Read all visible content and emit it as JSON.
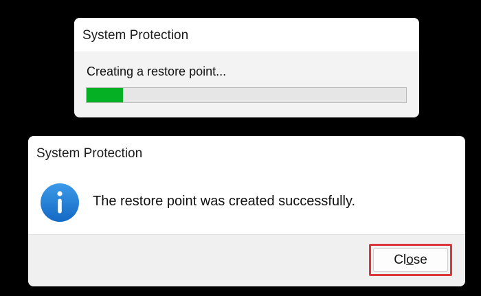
{
  "progress_dialog": {
    "title": "System Protection",
    "status_text": "Creating a restore point...",
    "progress_fraction": 0.115,
    "progress_color": "#06b025"
  },
  "result_dialog": {
    "title": "System Protection",
    "icon": "info-icon",
    "icon_color": "#1f7fd4",
    "message": "The restore point was created successfully.",
    "close_button": {
      "label_before": "Cl",
      "label_mnemonic": "o",
      "label_after": "se",
      "highlight_color": "#d9373b"
    }
  }
}
